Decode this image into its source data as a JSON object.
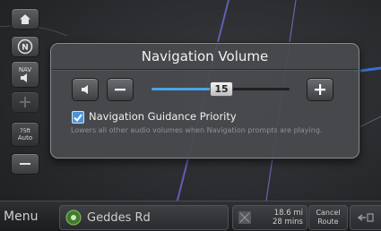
{
  "dialog": {
    "title": "Navigation Volume",
    "volume": {
      "value": 15,
      "max": 30,
      "display": "15"
    },
    "guidance": {
      "checked": true,
      "label": "Navigation Guidance Priority",
      "description": "Lowers all other audio volumes when Navigation prompts are playing."
    }
  },
  "left_controls": {
    "nav_label": "NAV",
    "scale_label": "75ft",
    "zoom_mode": "Auto"
  },
  "bottom_bar": {
    "menu_label": "Menu",
    "street": "Geddes Rd",
    "distance": "18.6 mi",
    "time": "28 mins",
    "cancel_line1": "Cancel",
    "cancel_line2": "Route"
  },
  "icons": {
    "home": "home-icon",
    "compass": "compass-icon",
    "speaker": "speaker-icon",
    "zoom_in": "plus-icon",
    "zoom_out": "minus-icon",
    "gps": "gps-signal-icon",
    "route": "route-icon"
  },
  "colors": {
    "accent": "#4aa4e8",
    "checkbox": "#4d94d6",
    "map_road": "#5b5fd6"
  }
}
